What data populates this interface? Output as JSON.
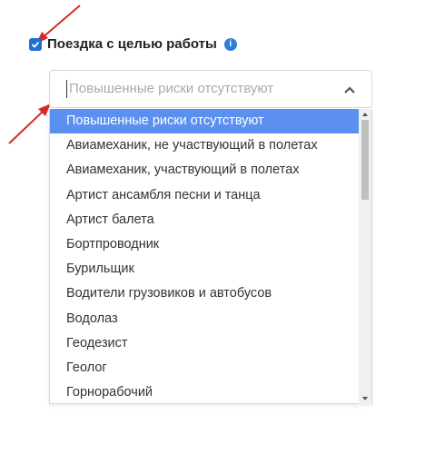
{
  "checkbox": {
    "checked": true,
    "label": "Поездка с целью работы",
    "info_icon": "i"
  },
  "select": {
    "placeholder": "Повышенные риски отсутствуют",
    "chevron": "chevron-up-icon"
  },
  "dropdown": {
    "items": [
      {
        "label": "Повышенные риски отсутствуют",
        "selected": true
      },
      {
        "label": "Авиамеханик, не участвующий в полетах"
      },
      {
        "label": "Авиамеханик, участвующий в полетах"
      },
      {
        "label": "Артист ансамбля песни и танца"
      },
      {
        "label": "Артист балета"
      },
      {
        "label": "Бортпроводник"
      },
      {
        "label": "Бурильщик"
      },
      {
        "label": "Водители грузовиков и автобусов"
      },
      {
        "label": "Водолаз"
      },
      {
        "label": "Геодезист"
      },
      {
        "label": "Геолог"
      },
      {
        "label": "Горнорабочий"
      }
    ]
  },
  "colors": {
    "accent": "#1f6fd1",
    "highlight": "#5b8ff0",
    "annotation": "#d42a2a"
  }
}
